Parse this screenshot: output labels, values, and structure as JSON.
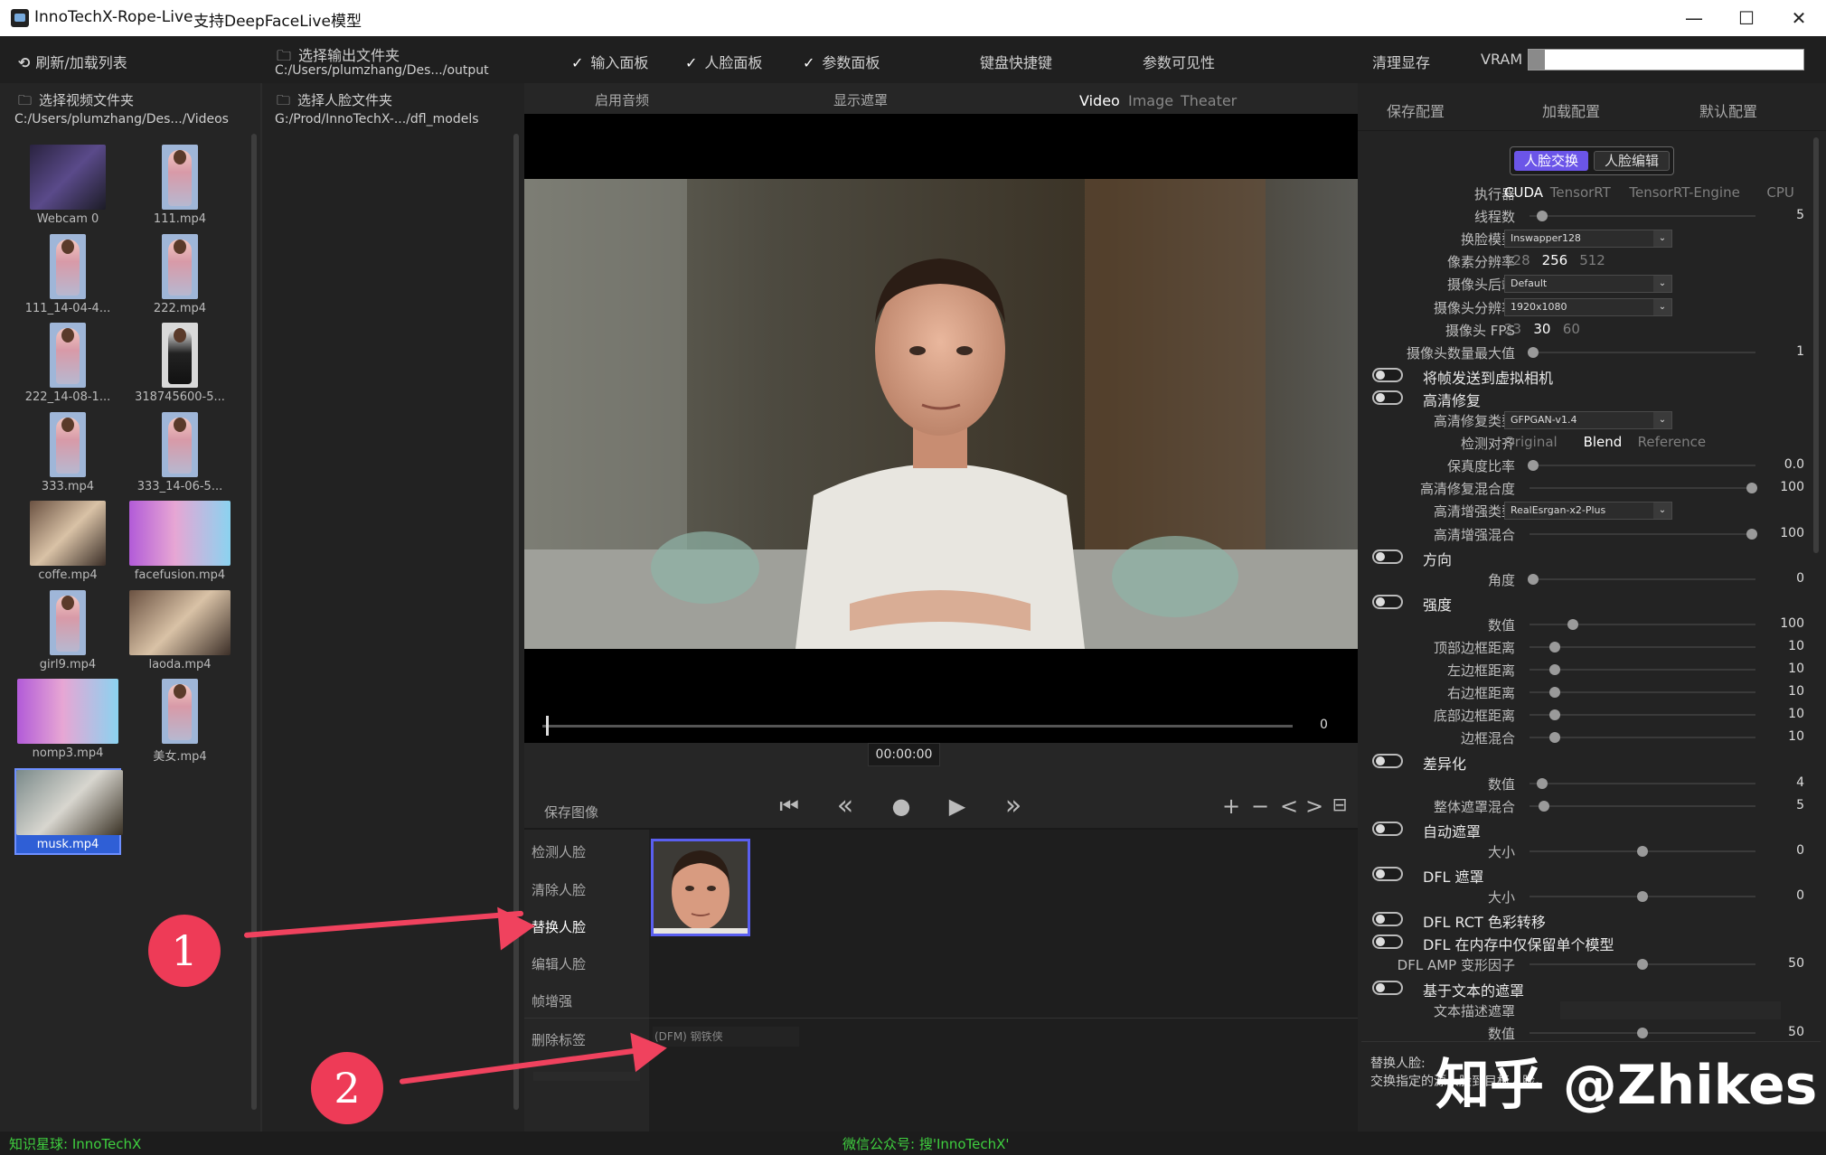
{
  "window": {
    "app_name": "InnoTechX-Rope-Live",
    "subtitle": "支持DeepFaceLive模型",
    "minimize": "—",
    "maximize": "☐",
    "close": "✕"
  },
  "toolbar": {
    "refresh_label": "刷新/加载列表",
    "output_folder_label": "选择输出文件夹",
    "output_folder_path": "C:/Users/plumzhang/Des.../output",
    "video_folder_label": "选择视频文件夹",
    "video_folder_path": "C:/Users/plumzhang/Des.../Videos",
    "face_folder_label": "选择人脸文件夹",
    "face_folder_path": "G:/Prod/InnoTechX-.../dfl_models",
    "input_panel": "输入面板",
    "face_panel": "人脸面板",
    "param_panel": "参数面板",
    "keyboard_shortcuts": "键盘快捷键",
    "param_visibility": "参数可见性",
    "clear_vram": "清理显存",
    "vram_label": "VRAM",
    "vram_usage": 0.06
  },
  "video_tabs": {
    "enable_audio": "启用音频",
    "show_mask": "显示遮罩",
    "video": "Video",
    "image": "Image",
    "theater": "Theater"
  },
  "thumbnails": [
    {
      "caption": "Webcam 0",
      "kind": "webcam"
    },
    {
      "caption": "111.mp4",
      "kind": "girl"
    },
    {
      "caption": "111_14-04-4...",
      "kind": "girl"
    },
    {
      "caption": "222.mp4",
      "kind": "girl"
    },
    {
      "caption": "222_14-08-1...",
      "kind": "girl"
    },
    {
      "caption": "318745600-5...",
      "kind": "suit"
    },
    {
      "caption": "333.mp4",
      "kind": "girl"
    },
    {
      "caption": "333_14-06-5...",
      "kind": "girl"
    },
    {
      "caption": "coffe.mp4",
      "kind": "wide"
    },
    {
      "caption": "facefusion.mp4",
      "kind": "wide-pink"
    },
    {
      "caption": "girl9.mp4",
      "kind": "girl"
    },
    {
      "caption": "laoda.mp4",
      "kind": "wide"
    },
    {
      "caption": "nomp3.mp4",
      "kind": "wide-pink"
    },
    {
      "caption": "美女.mp4",
      "kind": "girl"
    },
    {
      "caption": "musk.mp4",
      "kind": "selected"
    }
  ],
  "timeline": {
    "frame": "0",
    "time": "00:00:00",
    "position": 0.0
  },
  "faces_panel": {
    "save_image": "保存图像",
    "detect_face": "检测人脸",
    "clear_face": "清除人脸",
    "swap_face": "替换人脸",
    "edit_face": "编辑人脸",
    "frame_enhance": "帧增强",
    "delete_tag": "删除标签",
    "model_tag": "(DFM) 钢铁侠"
  },
  "playback": {
    "first": "⏮",
    "back": "«",
    "record": "●",
    "play": "▶",
    "forward": "»",
    "plus": "+",
    "minus": "−",
    "prev_marker": "<",
    "next_marker": ">",
    "save_marker": "⊟"
  },
  "annotations": {
    "badge1": "1",
    "badge2": "2"
  },
  "right_panel": {
    "save_config": "保存配置",
    "load_config": "加载配置",
    "default_config": "默认配置",
    "tab_swap": "人脸交换",
    "tab_edit": "人脸编辑",
    "executor": {
      "label": "执行器",
      "options": [
        "CUDA",
        "TensorRT",
        "TensorRT-Engine",
        "CPU"
      ],
      "active": 0
    },
    "threads": {
      "label": "线程数",
      "value": "5",
      "level": 0.04
    },
    "swap_model": {
      "label": "换脸模型",
      "value": "Inswapper128"
    },
    "pixel_res": {
      "label": "像素分辨率",
      "options": [
        "128",
        "256",
        "512"
      ],
      "active": 1
    },
    "camera_backend": {
      "label": "摄像头后端",
      "value": "Default"
    },
    "camera_res": {
      "label": "摄像头分辨率",
      "value": "1920x1080"
    },
    "camera_fps": {
      "label": "摄像头 FPS",
      "options": [
        "23",
        "30",
        "60"
      ],
      "active": 1
    },
    "camera_max": {
      "label": "摄像头数量最大值",
      "value": "1",
      "level": 0.0
    },
    "virtual_cam": "将帧发送到虚拟相机",
    "restore": "高清修复",
    "restore_type": {
      "label": "高清修复类型",
      "value": "GFPGAN-v1.4"
    },
    "detect_align": {
      "label": "检测对齐",
      "options": [
        "Original",
        "Blend",
        "Reference"
      ],
      "active": 1
    },
    "fidelity": {
      "label": "保真度比率",
      "value": "0.0",
      "level": 0.0
    },
    "restore_blend": {
      "label": "高清修复混合度",
      "value": "100",
      "level": 1.0
    },
    "enhance_type": {
      "label": "高清增强类型",
      "value": "RealEsrgan-x2-Plus"
    },
    "enhance_blend": {
      "label": "高清增强混合",
      "value": "100",
      "level": 1.0
    },
    "orientation": "方向",
    "angle": {
      "label": "角度",
      "value": "0",
      "level": 0.0
    },
    "strength": "强度",
    "strength_value": {
      "label": "数值",
      "value": "100",
      "level": 0.18
    },
    "top_border": {
      "label": "顶部边框距离",
      "value": "10",
      "level": 0.1
    },
    "left_border": {
      "label": "左边框距离",
      "value": "10",
      "level": 0.1
    },
    "right_border": {
      "label": "右边框距离",
      "value": "10",
      "level": 0.1
    },
    "bottom_border": {
      "label": "底部边框距离",
      "value": "10",
      "level": 0.1
    },
    "border_blend": {
      "label": "边框混合",
      "value": "10",
      "level": 0.1
    },
    "diff": "差异化",
    "diff_value": {
      "label": "数值",
      "value": "4",
      "level": 0.04
    },
    "overall_mask_blend": {
      "label": "整体遮罩混合",
      "value": "5",
      "level": 0.05
    },
    "auto_mask": "自动遮罩",
    "auto_mask_size": {
      "label": "大小",
      "value": "0",
      "level": 0.5
    },
    "dfl_mask": "DFL 遮罩",
    "dfl_mask_size": {
      "label": "大小",
      "value": "0",
      "level": 0.5
    },
    "dfl_rct": "DFL RCT 色彩转移",
    "dfl_single": "DFL 在内存中仅保留单个模型",
    "dfl_amp": {
      "label": "DFL AMP 变形因子",
      "value": "50",
      "level": 0.5
    },
    "text_mask": "基于文本的遮罩",
    "text_desc": {
      "label": "文本描述遮罩"
    },
    "text_value": {
      "label": "数值",
      "value": "50",
      "level": 0.5
    },
    "help_title": "替换人脸:",
    "help_text": "交换指定的源人脸到目标人脸。"
  },
  "watermark": "知乎 @Zhikes",
  "status": {
    "left": "知识星球: InnoTechX",
    "center": "微信公众号: 搜'InnoTechX'"
  }
}
